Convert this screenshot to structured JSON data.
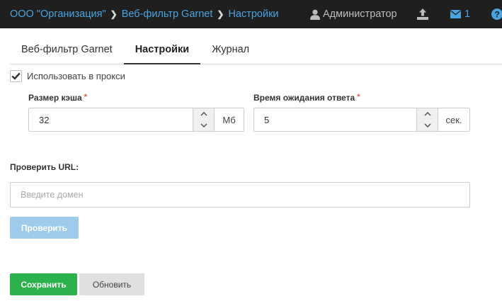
{
  "header": {
    "breadcrumbs": [
      "ООО \"Организация\"",
      "Веб-фильтр Garnet",
      "Настройки"
    ],
    "user_name": "Администратор",
    "messages_count": "1"
  },
  "tabs": [
    {
      "label": "Веб-фильтр Garnet",
      "active": false
    },
    {
      "label": "Настройки",
      "active": true
    },
    {
      "label": "Журнал",
      "active": false
    }
  ],
  "proxy": {
    "label": "Использовать в прокси",
    "checked": true
  },
  "cache": {
    "label": "Размер кэша",
    "required_mark": "*",
    "value": "32",
    "unit": "Мб"
  },
  "timeout": {
    "label": "Время ожидания ответа",
    "required_mark": "*",
    "value": "5",
    "unit": "сек."
  },
  "url_check": {
    "label": "Проверить URL:",
    "placeholder": "Введите домен",
    "value": "",
    "button": "Проверить"
  },
  "actions": {
    "save": "Сохранить",
    "refresh": "Обновить"
  },
  "colors": {
    "topbar": "#1f1f1f",
    "link": "#4aa3df",
    "save": "#2bb24c",
    "check_button": "#9ecbe9"
  }
}
